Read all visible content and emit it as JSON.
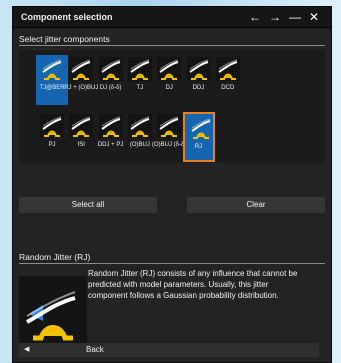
{
  "window": {
    "title": "Component selection"
  },
  "sections": {
    "select_label": "Select jitter components",
    "desc_label": "Random Jitter (RJ)"
  },
  "components": [
    {
      "label": "TJ@BER"
    },
    {
      "label": "RJ + (O)BUJ"
    },
    {
      "label": "DJ (δ-δ)"
    },
    {
      "label": "TJ"
    },
    {
      "label": "DJ"
    },
    {
      "label": "DDJ"
    },
    {
      "label": "DCD"
    },
    {
      "label": "PJ"
    },
    {
      "label": "ISI"
    },
    {
      "label": "DDJ + PJ"
    },
    {
      "label": "(O)BUJ"
    },
    {
      "label": "(O)BUJ (δ-δ)"
    },
    {
      "label": "RJ"
    }
  ],
  "buttons": {
    "select_all": "Select all",
    "clear": "Clear",
    "back": "Back"
  },
  "description": "Random Jitter (RJ) consists of any influence that cannot be predicted with model parameters. Usually, this jitter component follows a Gaussian probability distribution.",
  "colors": {
    "accent_blue": "#1565b0",
    "selection_orange": "#e8821e",
    "curve_yellow": "#f2c200"
  },
  "icons": {
    "back": "arrow-left-icon",
    "forward": "arrow-right-icon",
    "minimize": "minimize-icon",
    "close": "close-icon"
  }
}
